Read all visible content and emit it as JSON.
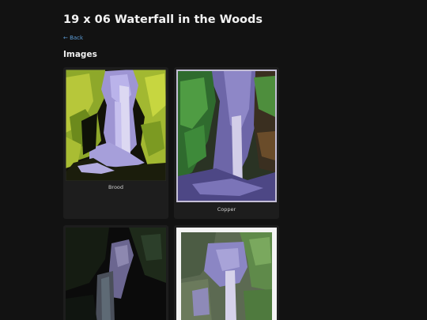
{
  "page": {
    "title": "19 x 06 Waterfall in the Woods",
    "back_link": "← Back",
    "images_heading": "Images"
  },
  "images": [
    {
      "caption": "Brood"
    },
    {
      "caption": "Copper"
    },
    {
      "caption": ""
    },
    {
      "caption": ""
    }
  ],
  "colors": {
    "background": "#121212",
    "card": "#1d1d1d",
    "link": "#5b9bd5"
  }
}
